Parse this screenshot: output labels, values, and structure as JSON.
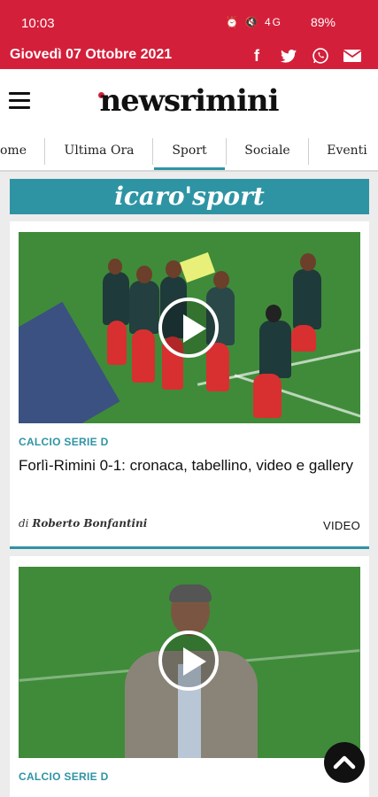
{
  "status_bar": {
    "time": "10:03",
    "icons": "⏰ 🔇 4G",
    "battery": "89%"
  },
  "date_bar": {
    "date": "Giovedì 07 Ottobre 2021"
  },
  "social": {
    "facebook": "f",
    "twitter": "🐦",
    "whatsapp": "✆",
    "email": "✉"
  },
  "header": {
    "logo": "newsrimini"
  },
  "nav": {
    "items": [
      {
        "label": "ome"
      },
      {
        "label": "Ultima Ora"
      },
      {
        "label": "Sport"
      },
      {
        "label": "Sociale"
      },
      {
        "label": "Eventi"
      }
    ]
  },
  "banner": {
    "text": "icaro'sport"
  },
  "articles": [
    {
      "category": "CALCIO SERIE D",
      "title": "Forlì-Rimini 0-1: cronaca, tabellino, video e gallery",
      "byline_prefix": "di",
      "author": "Roberto Bonfantini",
      "media_label": "VIDEO"
    },
    {
      "category": "CALCIO SERIE D"
    }
  ],
  "colors": {
    "brand_red": "#d41f3a",
    "accent_teal": "#2e94a4"
  }
}
